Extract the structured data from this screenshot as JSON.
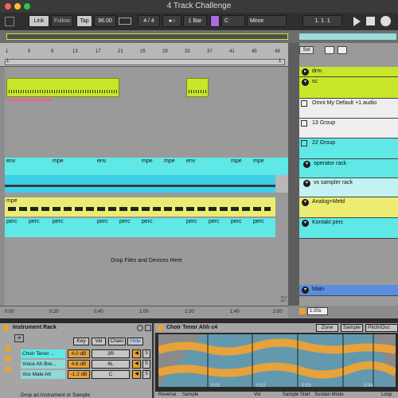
{
  "window": {
    "title": "4 Track Challenge"
  },
  "transport": {
    "link": "Link",
    "follow": "Follow",
    "tap": "Tap",
    "tempo": "96.00",
    "signature": "4 / 4",
    "metronome": "●○",
    "quantize": "1 Bar",
    "key": "C",
    "scale": "Minor",
    "position": "1.   1.   1"
  },
  "ruler": {
    "bars": [
      "1",
      "5",
      "9",
      "13",
      "17",
      "21",
      "25",
      "29",
      "33",
      "37",
      "41",
      "45",
      "49"
    ],
    "start_marker": "1",
    "end_marker": "1"
  },
  "timeline": {
    "labels": [
      "0:00",
      "0:20",
      "0:40",
      "1:00",
      "1:20",
      "1:40",
      "2:00"
    ]
  },
  "clips": {
    "env": "env",
    "mpe": "mpe",
    "perc": "perc"
  },
  "drop_hint": "Drop Files and Devices Here",
  "tracks": {
    "set_label": "Set",
    "items": [
      {
        "name": "drm"
      },
      {
        "name": "sc"
      },
      {
        "name": "Omni My Default +1 audio"
      },
      {
        "name": "13 Group"
      },
      {
        "name": "22 Group"
      },
      {
        "name": "operator rack"
      },
      {
        "name": "vx sampler rack"
      },
      {
        "name": "Analog+Meld"
      },
      {
        "name": "Kontakt perc"
      },
      {
        "name": "Main"
      }
    ],
    "page_indicator": "2/1",
    "zoom": "1.00x"
  },
  "rack": {
    "title": "Instrument Rack",
    "buttons": {
      "key": "Key",
      "vel": "Vel",
      "chain": "Chain",
      "hide": "Hide"
    },
    "chains": [
      {
        "name": "Choir Tenor ...",
        "db": "4.0 dB",
        "pan": "3R",
        "solo": "S"
      },
      {
        "name": "Voice Ah Bre...",
        "db": "4.8 dB",
        "pan": "6L",
        "solo": "S"
      },
      {
        "name": "Vox Male Ah",
        "db": "-1.2 dB",
        "pan": "C",
        "solo": "S"
      }
    ],
    "drop_text": "Drop an Instrument or Sample"
  },
  "clip_view": {
    "title": "Choir Tenor Ahh c4",
    "zone": "Zone",
    "sample": "Sample",
    "pitch": "Pitch/Osc",
    "markers": [
      "0:01",
      "0:02",
      "0:03",
      "0:04"
    ],
    "bottom_labels": [
      "Reverse",
      "Sample",
      "Vol",
      "Sample Start",
      "Sustain Mode",
      "Loop"
    ]
  },
  "colors": {
    "lime": "#c8e62a",
    "cyan": "#5fe8e6",
    "yellow": "#ecec72",
    "blue": "#5a8de0",
    "orange": "#e8a23a"
  }
}
